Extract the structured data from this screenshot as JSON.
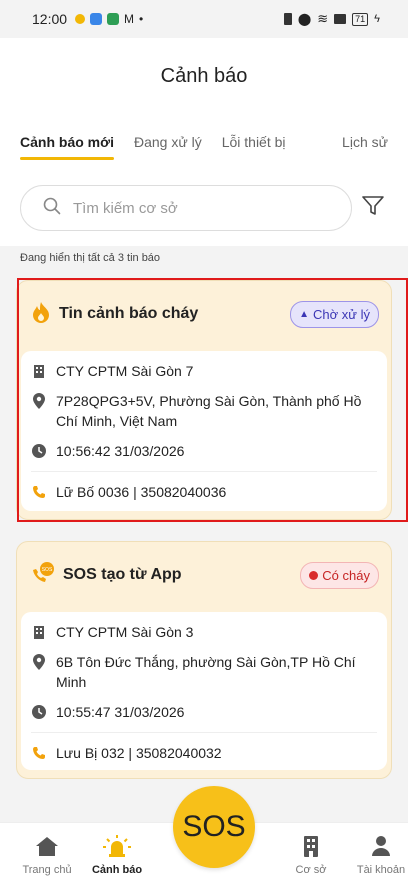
{
  "status_bar": {
    "time": "12:00",
    "battery": "71"
  },
  "header": {
    "title": "Cảnh báo"
  },
  "tabs": [
    {
      "label": "Cảnh báo mới",
      "active": true
    },
    {
      "label": "Đang xử lý",
      "active": false
    },
    {
      "label": "Lỗi thiết bị",
      "active": false
    },
    {
      "label": "Lịch sử",
      "active": false
    }
  ],
  "search": {
    "placeholder": "Tìm kiếm cơ sở",
    "value": ""
  },
  "count_text": "Đang hiển thị tất cả 3 tin báo",
  "alerts": [
    {
      "title": "Tin cảnh báo cháy",
      "status": "Chờ xử lý",
      "facility": "CTY CPTM Sài Gòn 7",
      "address": "7P28QPG3+5V, Phường Sài Gòn, Thành phố Hồ Chí Minh, Việt Nam",
      "time": "10:56:42 31/03/2026",
      "contact": "Lữ Bố 0036 | 35082040036"
    },
    {
      "title": "SOS tạo từ App",
      "status": "Có cháy",
      "facility": "CTY CPTM Sài Gòn 3",
      "address": "6B Tôn Đức Thắng, phường Sài Gòn,TP Hồ Chí Minh",
      "time": "10:55:47 31/03/2026",
      "contact": "Lưu Bị 032 | 35082040032"
    }
  ],
  "nav": {
    "home": "Trang chủ",
    "alerts": "Cảnh báo",
    "sos": "SOS",
    "facilities": "Cơ sở",
    "account": "Tài khoản"
  },
  "colors": {
    "accent": "#f2b705",
    "card_bg": "#fdf1d9",
    "selection": "#e01a1a"
  }
}
